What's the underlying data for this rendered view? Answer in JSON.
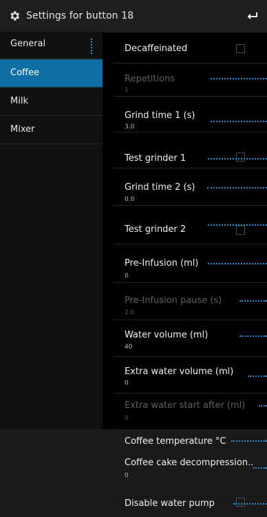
{
  "header": {
    "title": "Settings for button 18",
    "gear_icon": "gear-icon",
    "back_icon": "back-arrow-icon"
  },
  "sidebar": {
    "items": [
      {
        "label": "General"
      },
      {
        "label": "Coffee"
      },
      {
        "label": "Milk"
      },
      {
        "label": "Mixer"
      }
    ],
    "active_index": 1
  },
  "settings": {
    "decaffeinated": {
      "label": "Decaffeinated"
    },
    "repetitions": {
      "label": "Repetitions",
      "value": "1"
    },
    "grind_time_1": {
      "label": "Grind time 1 (s)",
      "value": "3.0"
    },
    "test_grinder_1": {
      "label": "Test grinder 1"
    },
    "grind_time_2": {
      "label": "Grind time 2 (s)",
      "value": "0.0"
    },
    "test_grinder_2": {
      "label": "Test grinder 2"
    },
    "pre_infusion": {
      "label": "Pre-Infusion (ml)",
      "value": "0"
    },
    "pre_infusion_pause": {
      "label": "Pre-Infusion pause (s)",
      "value": "2.0"
    },
    "water_volume": {
      "label": "Water volume (ml)",
      "value": "40"
    },
    "extra_water_volume": {
      "label": "Extra water volume (ml)",
      "value": "0"
    },
    "extra_water_start": {
      "label": "Extra water start after (ml)",
      "value": "0"
    },
    "coffee_temperature": {
      "label": "Coffee temperature °C"
    },
    "coffee_cake_decompression": {
      "label": "Coffee cake decompression..",
      "value": "0"
    },
    "disable_water_pump": {
      "label": "Disable water pump"
    }
  },
  "colors": {
    "accent": "#0f6fa3",
    "dots": "#2f8fd6",
    "background": "#000000"
  }
}
